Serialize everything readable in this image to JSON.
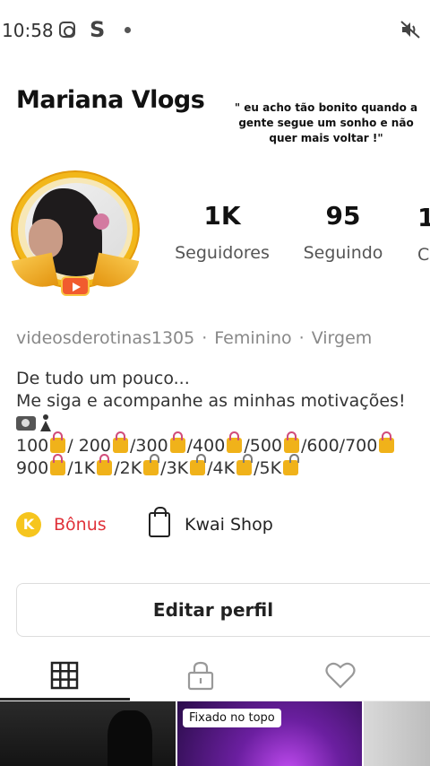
{
  "status_bar": {
    "time": "10:58",
    "icons": [
      "instagram-icon",
      "s-app-icon",
      "notification-dot-icon",
      "mute-icon"
    ],
    "app_letter": "S"
  },
  "profile": {
    "name": "Mariana Vlogs",
    "quote": "\" eu acho tão bonito quando a gente segue um sonho e não quer mais voltar !\"",
    "stats": {
      "followers_value": "1K",
      "followers_label": "Seguidores",
      "following_value": "95",
      "following_label": "Seguindo",
      "third_value": "1",
      "third_label": "C"
    },
    "meta": {
      "username": "videosderotinas1305",
      "separator": "·",
      "gender": "Feminino",
      "sign": "Virgem"
    },
    "bio": {
      "line1": "De tudo um pouco...",
      "line2": "Me siga e acompanhe as minhas motivações!",
      "goals_line1": [
        "100",
        "/ 200",
        "/300",
        "/400",
        "/500",
        "/600/700"
      ],
      "goals_line2": [
        "900",
        "/1K",
        "/2K",
        "/3K",
        "/4K",
        "/5K"
      ]
    }
  },
  "actions": {
    "bonus_icon_letter": "K",
    "bonus_label": "Bônus",
    "shop_label": "Kwai Shop",
    "edit_profile_label": "Editar perfil"
  },
  "tabs": [
    {
      "name": "grid",
      "icon": "grid-icon",
      "active": true
    },
    {
      "name": "private",
      "icon": "lock-icon",
      "active": false
    },
    {
      "name": "liked",
      "icon": "heart-icon",
      "active": false
    }
  ],
  "thumbnails": {
    "pinned_label": "Fixado no topo"
  },
  "colors": {
    "accent_red": "#e0323a",
    "gold": "#f2b71a",
    "text": "#222222",
    "muted": "#888888"
  }
}
